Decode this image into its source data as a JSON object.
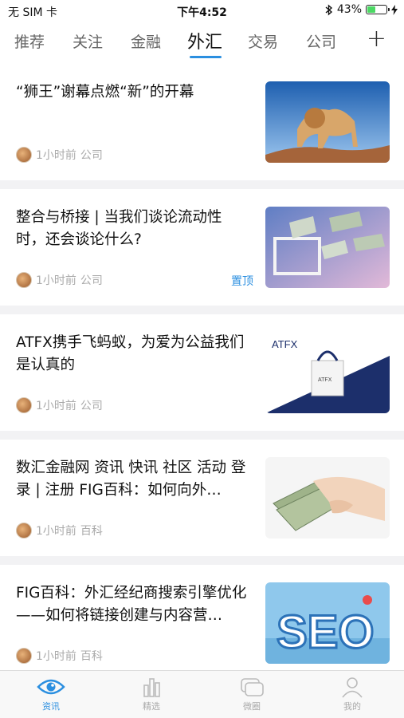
{
  "status_bar": {
    "carrier": "无 SIM 卡",
    "time": "下午4:52",
    "battery": "43%",
    "battery_level": 0.43
  },
  "tabs": {
    "items": [
      "推荐",
      "关注",
      "金融",
      "外汇",
      "交易",
      "公司"
    ],
    "active": "外汇",
    "add_label": "+"
  },
  "feed": [
    {
      "title": "“狮王”谢幕点燃“新”的开幕",
      "time": "1小时前",
      "tag": "公司",
      "pinned": ""
    },
    {
      "title": "整合与桥接 | 当我们谈论流动性时，还会谈论什么?",
      "time": "1小时前",
      "tag": "公司",
      "pinned": "置顶"
    },
    {
      "title": "ATFX携手飞蚂蚁，为爱为公益我们是认真的",
      "time": "1小时前",
      "tag": "公司",
      "pinned": ""
    },
    {
      "title": "数汇金融网 资讯 快讯 社区 活动 登录 | 注册 FIG百科：如何向外…",
      "time": "1小时前",
      "tag": "百科",
      "pinned": ""
    },
    {
      "title": "FIG百科：外汇经纪商搜索引擎优化——如何将链接创建与内容营…",
      "time": "1小时前",
      "tag": "百科",
      "pinned": ""
    }
  ],
  "thumb_text": {
    "atfx_logo": "ATFX",
    "atfx_bag": "ATFX",
    "seo": "SEO"
  },
  "bottom_nav": [
    {
      "label": "资讯",
      "icon": "eye-icon",
      "active": true
    },
    {
      "label": "精选",
      "icon": "bar-chart-icon",
      "active": false
    },
    {
      "label": "微圈",
      "icon": "chat-icon",
      "active": false
    },
    {
      "label": "我的",
      "icon": "user-icon",
      "active": false
    }
  ],
  "colors": {
    "accent": "#2b8fe0",
    "battery": "#4cd964"
  }
}
